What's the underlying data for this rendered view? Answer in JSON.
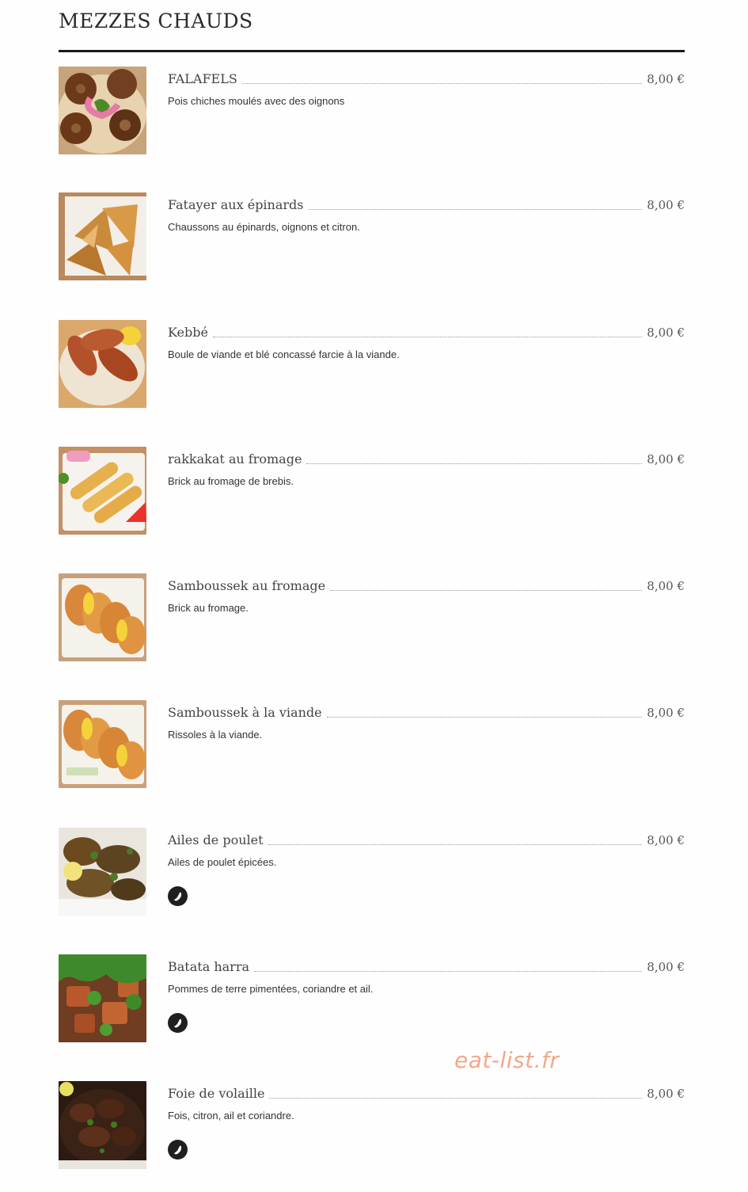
{
  "section": {
    "title": "MEZZES CHAUDS"
  },
  "items": [
    {
      "name": "FALAFELS",
      "price": "8,00 €",
      "description": "Pois chiches moulés avec des oignons",
      "spicy": false,
      "image": "falafel-photo"
    },
    {
      "name": "Fatayer aux épinards",
      "price": "8,00 €",
      "description": "Chaussons au épinards, oignons et citron.",
      "spicy": false,
      "image": "fatayer-photo"
    },
    {
      "name": "Kebbé",
      "price": "8,00 €",
      "description": "Boule de viande et blé concassé farcie à la viande.",
      "spicy": false,
      "image": "kebbe-photo"
    },
    {
      "name": "rakkakat au fromage",
      "price": "8,00 €",
      "description": "Brick au fromage de brebis.",
      "spicy": false,
      "image": "rakkakat-photo"
    },
    {
      "name": "Samboussek au fromage",
      "price": "8,00 €",
      "description": "Brick au fromage.",
      "spicy": false,
      "image": "samboussek-cheese-photo"
    },
    {
      "name": "Samboussek à la viande",
      "price": "8,00 €",
      "description": "Rissoles à la viande.",
      "spicy": false,
      "image": "samboussek-meat-photo"
    },
    {
      "name": "Ailes de poulet",
      "price": "8,00 €",
      "description": "Ailes de poulet épicées.",
      "spicy": true,
      "image": "chicken-wings-photo"
    },
    {
      "name": "Batata harra",
      "price": "8,00 €",
      "description": "Pommes de terre pimentées, coriandre et ail.",
      "spicy": true,
      "image": "batata-harra-photo"
    },
    {
      "name": "Foie de volaille",
      "price": "8,00 €",
      "description": "Fois, citron, ail et coriandre.",
      "spicy": true,
      "image": "chicken-liver-photo"
    }
  ],
  "watermark": "eat-list.fr"
}
